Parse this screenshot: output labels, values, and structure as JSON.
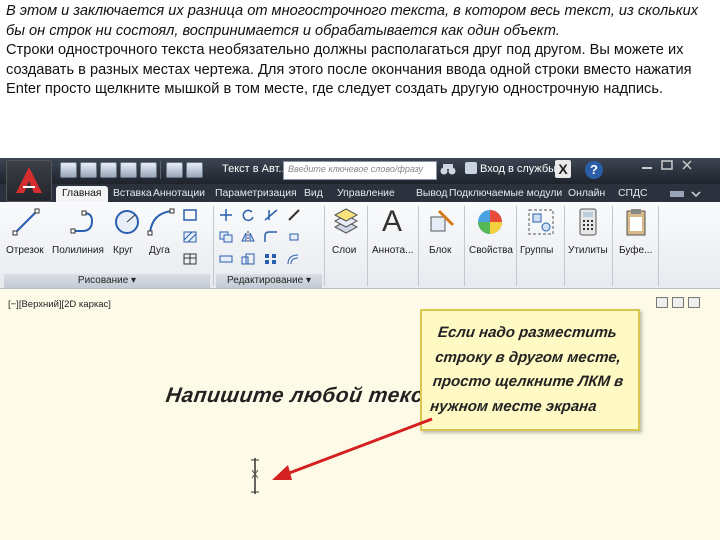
{
  "intro": {
    "paragraph1": "В этом и заключается их разница от многострочного текста, в котором весь текст, из скольких бы он строк ни состоял, воспринимается и обрабатывается как один объект.",
    "paragraph2": "Строки однострочного текста необязательно должны располагаться друг под другом. Вы можете их создавать в разных местах чертежа. Для этого после окончания ввода одной строки вместо нажатия Enter просто щелкните мышкой в том месте, где следует создать другую однострочную надпись."
  },
  "titlebar": {
    "document_title": "Текст в Авт...",
    "search_placeholder": "Введите ключевое слово/фразу",
    "services_label": "Вход в службы",
    "help_label": "?"
  },
  "tabs": [
    "Главная",
    "Вставка",
    "Аннотации",
    "Параметризация",
    "Вид",
    "Управление",
    "Вывод",
    "Подключаемые модули",
    "Онлайн",
    "СПДС"
  ],
  "active_tab": "Главная",
  "ribbon": {
    "draw_tools": [
      "Отрезок",
      "Полилиния",
      "Круг",
      "Дуга"
    ],
    "big_tools": [
      "Слои",
      "Аннота...",
      "Блок",
      "Свойства",
      "Группы",
      "Утилиты",
      "Буфе..."
    ],
    "panels": {
      "draw": "Рисование",
      "modify": "Редактирование"
    }
  },
  "canvas": {
    "viewport_label": "[−][Верхний][2D каркас]",
    "drawing_text": "Напишите любой текст",
    "note": "Если надо разместить строку в другом месте, просто щелкните ЛКМ в нужном месте экрана"
  },
  "colors": {
    "title_bar": "#2b323d",
    "canvas_bg": "#fdfbe7",
    "note_bg": "#fff9c4",
    "arrow": "#d42020"
  }
}
